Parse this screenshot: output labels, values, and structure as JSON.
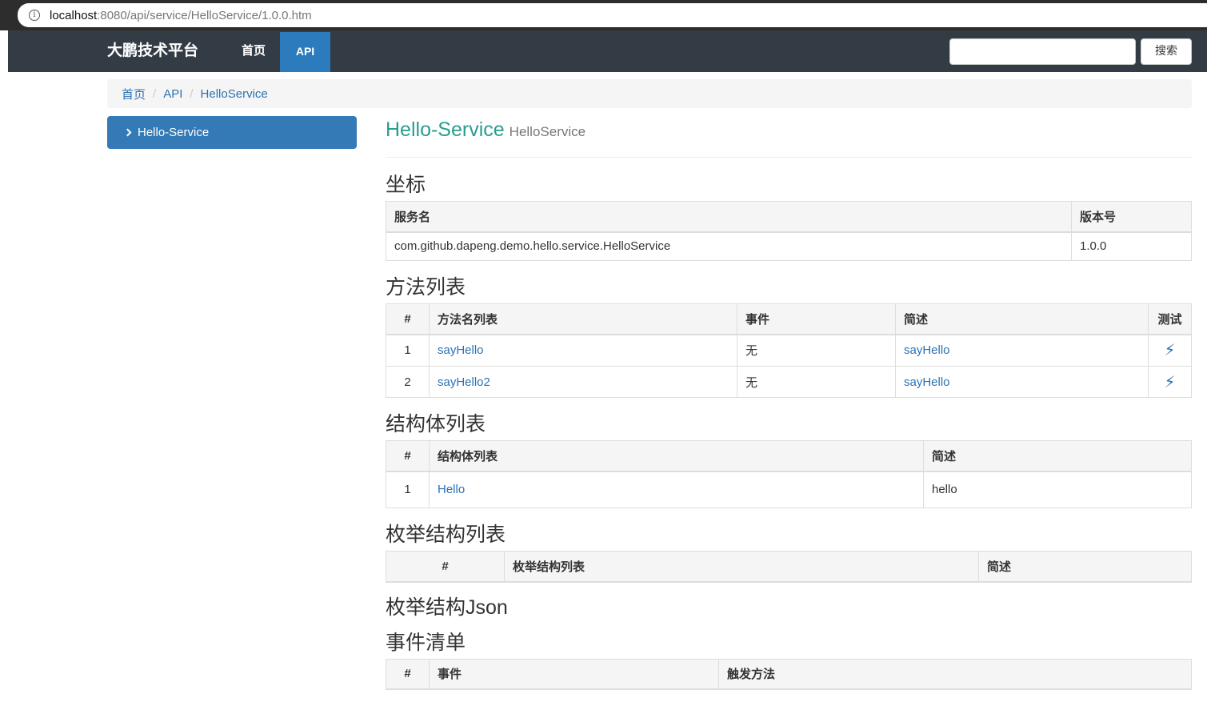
{
  "browser": {
    "url_host": "localhost",
    "url_path": ":8080/api/service/HelloService/1.0.0.htm"
  },
  "navbar": {
    "brand": "大鹏技术平台",
    "home": "首页",
    "api": "API",
    "search_placeholder": "",
    "search_button": "搜索"
  },
  "breadcrumb": {
    "home": "首页",
    "api": "API",
    "current": "HelloService",
    "separator": "/"
  },
  "sidebar": {
    "items": [
      {
        "label": "Hello-Service"
      }
    ]
  },
  "header": {
    "title": "Hello-Service",
    "subtitle": "HelloService"
  },
  "coordinates": {
    "title": "坐标",
    "headers": [
      "服务名",
      "版本号"
    ],
    "rows": [
      [
        "com.github.dapeng.demo.hello.service.HelloService",
        "1.0.0"
      ]
    ]
  },
  "methods": {
    "title": "方法列表",
    "headers": [
      "#",
      "方法名列表",
      "事件",
      "简述",
      "测试"
    ],
    "rows": [
      {
        "num": "1",
        "name": "sayHello",
        "event": "无",
        "desc": "sayHello",
        "test_icon": "bolt-icon"
      },
      {
        "num": "2",
        "name": "sayHello2",
        "event": "无",
        "desc": "sayHello",
        "test_icon": "bolt-icon"
      }
    ]
  },
  "structs": {
    "title": "结构体列表",
    "headers": [
      "#",
      "结构体列表",
      "简述"
    ],
    "rows": [
      {
        "num": "1",
        "name": "Hello",
        "desc": "hello"
      }
    ]
  },
  "enums": {
    "title": "枚举结构列表",
    "headers": [
      "#",
      "枚举结构列表",
      "简述"
    ]
  },
  "enum_json": {
    "title": "枚举结构Json"
  },
  "events": {
    "title": "事件清单",
    "headers": [
      "#",
      "事件",
      "触发方法"
    ]
  },
  "colors": {
    "navbar": "#333c45",
    "accent": "#337ab7",
    "title_teal": "#2a9d8f",
    "link": "#2a72b5"
  }
}
